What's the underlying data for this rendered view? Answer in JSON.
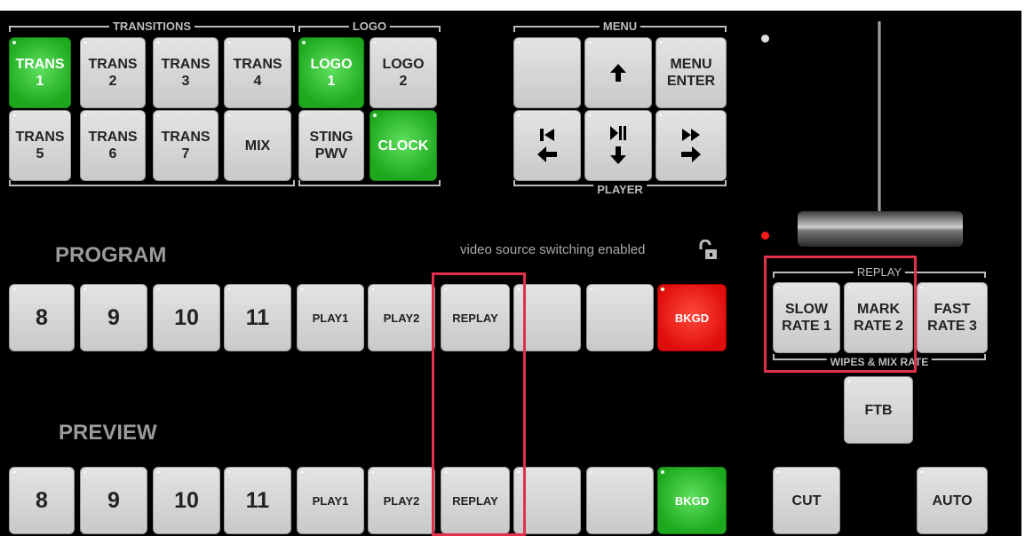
{
  "groups": {
    "transitions": "TRANSITIONS",
    "logo": "LOGO",
    "menu": "MENU",
    "player": "PLAYER",
    "replay": "REPLAY",
    "wipes_mix_rate": "WIPES & MIX RATE"
  },
  "transitions": [
    "TRANS\n1",
    "TRANS\n2",
    "TRANS\n3",
    "TRANS\n4",
    "TRANS\n5",
    "TRANS\n6",
    "TRANS\n7",
    "MIX"
  ],
  "logo_buttons": [
    "LOGO\n1",
    "LOGO\n2",
    "STING\nPWV",
    "CLOCK"
  ],
  "menu": {
    "blank": "",
    "up_icon": "arrow-up-icon",
    "enter": "MENU\nENTER",
    "prev_icon": "skip-previous-left-icon",
    "playpause_icon": "play-pause-down-icon",
    "ff_icon": "fast-forward-right-icon"
  },
  "program": {
    "label": "PROGRAM",
    "buttons": [
      "8",
      "9",
      "10",
      "11",
      "PLAY1",
      "PLAY2",
      "REPLAY",
      "",
      "",
      "BKGD"
    ]
  },
  "preview": {
    "label": "PREVIEW",
    "buttons": [
      "8",
      "9",
      "10",
      "11",
      "PLAY1",
      "PLAY2",
      "REPLAY",
      "",
      "",
      "BKGD"
    ]
  },
  "status": "video source switching enabled",
  "rates": [
    "SLOW\nRATE 1",
    "MARK\nRATE 2",
    "FAST\nRATE 3"
  ],
  "ftb": "FTB",
  "cut": "CUT",
  "auto": "AUTO",
  "colors": {
    "active_green": "#1da81d",
    "active_red": "#e00d0d",
    "highlight": "#e0304a"
  }
}
